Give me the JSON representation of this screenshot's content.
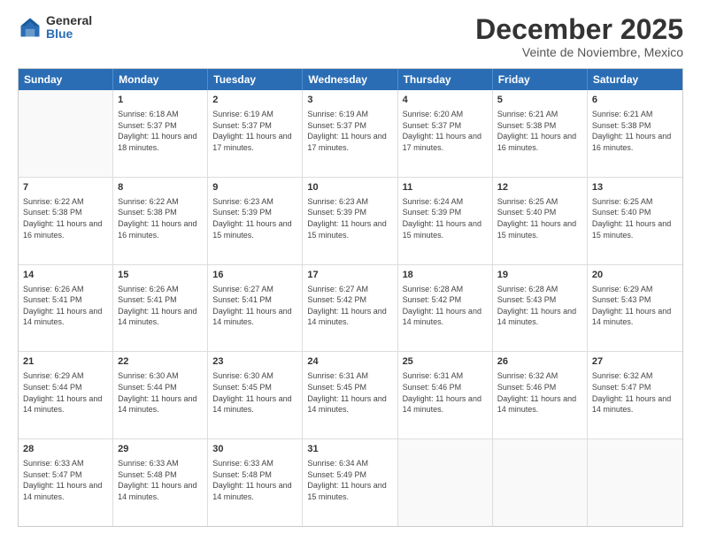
{
  "logo": {
    "general": "General",
    "blue": "Blue"
  },
  "title": "December 2025",
  "subtitle": "Veinte de Noviembre, Mexico",
  "header_days": [
    "Sunday",
    "Monday",
    "Tuesday",
    "Wednesday",
    "Thursday",
    "Friday",
    "Saturday"
  ],
  "rows": [
    [
      {
        "day": "",
        "sunrise": "",
        "sunset": "",
        "daylight": ""
      },
      {
        "day": "1",
        "sunrise": "Sunrise: 6:18 AM",
        "sunset": "Sunset: 5:37 PM",
        "daylight": "Daylight: 11 hours and 18 minutes."
      },
      {
        "day": "2",
        "sunrise": "Sunrise: 6:19 AM",
        "sunset": "Sunset: 5:37 PM",
        "daylight": "Daylight: 11 hours and 17 minutes."
      },
      {
        "day": "3",
        "sunrise": "Sunrise: 6:19 AM",
        "sunset": "Sunset: 5:37 PM",
        "daylight": "Daylight: 11 hours and 17 minutes."
      },
      {
        "day": "4",
        "sunrise": "Sunrise: 6:20 AM",
        "sunset": "Sunset: 5:37 PM",
        "daylight": "Daylight: 11 hours and 17 minutes."
      },
      {
        "day": "5",
        "sunrise": "Sunrise: 6:21 AM",
        "sunset": "Sunset: 5:38 PM",
        "daylight": "Daylight: 11 hours and 16 minutes."
      },
      {
        "day": "6",
        "sunrise": "Sunrise: 6:21 AM",
        "sunset": "Sunset: 5:38 PM",
        "daylight": "Daylight: 11 hours and 16 minutes."
      }
    ],
    [
      {
        "day": "7",
        "sunrise": "Sunrise: 6:22 AM",
        "sunset": "Sunset: 5:38 PM",
        "daylight": "Daylight: 11 hours and 16 minutes."
      },
      {
        "day": "8",
        "sunrise": "Sunrise: 6:22 AM",
        "sunset": "Sunset: 5:38 PM",
        "daylight": "Daylight: 11 hours and 16 minutes."
      },
      {
        "day": "9",
        "sunrise": "Sunrise: 6:23 AM",
        "sunset": "Sunset: 5:39 PM",
        "daylight": "Daylight: 11 hours and 15 minutes."
      },
      {
        "day": "10",
        "sunrise": "Sunrise: 6:23 AM",
        "sunset": "Sunset: 5:39 PM",
        "daylight": "Daylight: 11 hours and 15 minutes."
      },
      {
        "day": "11",
        "sunrise": "Sunrise: 6:24 AM",
        "sunset": "Sunset: 5:39 PM",
        "daylight": "Daylight: 11 hours and 15 minutes."
      },
      {
        "day": "12",
        "sunrise": "Sunrise: 6:25 AM",
        "sunset": "Sunset: 5:40 PM",
        "daylight": "Daylight: 11 hours and 15 minutes."
      },
      {
        "day": "13",
        "sunrise": "Sunrise: 6:25 AM",
        "sunset": "Sunset: 5:40 PM",
        "daylight": "Daylight: 11 hours and 15 minutes."
      }
    ],
    [
      {
        "day": "14",
        "sunrise": "Sunrise: 6:26 AM",
        "sunset": "Sunset: 5:41 PM",
        "daylight": "Daylight: 11 hours and 14 minutes."
      },
      {
        "day": "15",
        "sunrise": "Sunrise: 6:26 AM",
        "sunset": "Sunset: 5:41 PM",
        "daylight": "Daylight: 11 hours and 14 minutes."
      },
      {
        "day": "16",
        "sunrise": "Sunrise: 6:27 AM",
        "sunset": "Sunset: 5:41 PM",
        "daylight": "Daylight: 11 hours and 14 minutes."
      },
      {
        "day": "17",
        "sunrise": "Sunrise: 6:27 AM",
        "sunset": "Sunset: 5:42 PM",
        "daylight": "Daylight: 11 hours and 14 minutes."
      },
      {
        "day": "18",
        "sunrise": "Sunrise: 6:28 AM",
        "sunset": "Sunset: 5:42 PM",
        "daylight": "Daylight: 11 hours and 14 minutes."
      },
      {
        "day": "19",
        "sunrise": "Sunrise: 6:28 AM",
        "sunset": "Sunset: 5:43 PM",
        "daylight": "Daylight: 11 hours and 14 minutes."
      },
      {
        "day": "20",
        "sunrise": "Sunrise: 6:29 AM",
        "sunset": "Sunset: 5:43 PM",
        "daylight": "Daylight: 11 hours and 14 minutes."
      }
    ],
    [
      {
        "day": "21",
        "sunrise": "Sunrise: 6:29 AM",
        "sunset": "Sunset: 5:44 PM",
        "daylight": "Daylight: 11 hours and 14 minutes."
      },
      {
        "day": "22",
        "sunrise": "Sunrise: 6:30 AM",
        "sunset": "Sunset: 5:44 PM",
        "daylight": "Daylight: 11 hours and 14 minutes."
      },
      {
        "day": "23",
        "sunrise": "Sunrise: 6:30 AM",
        "sunset": "Sunset: 5:45 PM",
        "daylight": "Daylight: 11 hours and 14 minutes."
      },
      {
        "day": "24",
        "sunrise": "Sunrise: 6:31 AM",
        "sunset": "Sunset: 5:45 PM",
        "daylight": "Daylight: 11 hours and 14 minutes."
      },
      {
        "day": "25",
        "sunrise": "Sunrise: 6:31 AM",
        "sunset": "Sunset: 5:46 PM",
        "daylight": "Daylight: 11 hours and 14 minutes."
      },
      {
        "day": "26",
        "sunrise": "Sunrise: 6:32 AM",
        "sunset": "Sunset: 5:46 PM",
        "daylight": "Daylight: 11 hours and 14 minutes."
      },
      {
        "day": "27",
        "sunrise": "Sunrise: 6:32 AM",
        "sunset": "Sunset: 5:47 PM",
        "daylight": "Daylight: 11 hours and 14 minutes."
      }
    ],
    [
      {
        "day": "28",
        "sunrise": "Sunrise: 6:33 AM",
        "sunset": "Sunset: 5:47 PM",
        "daylight": "Daylight: 11 hours and 14 minutes."
      },
      {
        "day": "29",
        "sunrise": "Sunrise: 6:33 AM",
        "sunset": "Sunset: 5:48 PM",
        "daylight": "Daylight: 11 hours and 14 minutes."
      },
      {
        "day": "30",
        "sunrise": "Sunrise: 6:33 AM",
        "sunset": "Sunset: 5:48 PM",
        "daylight": "Daylight: 11 hours and 14 minutes."
      },
      {
        "day": "31",
        "sunrise": "Sunrise: 6:34 AM",
        "sunset": "Sunset: 5:49 PM",
        "daylight": "Daylight: 11 hours and 15 minutes."
      },
      {
        "day": "",
        "sunrise": "",
        "sunset": "",
        "daylight": ""
      },
      {
        "day": "",
        "sunrise": "",
        "sunset": "",
        "daylight": ""
      },
      {
        "day": "",
        "sunrise": "",
        "sunset": "",
        "daylight": ""
      }
    ]
  ]
}
